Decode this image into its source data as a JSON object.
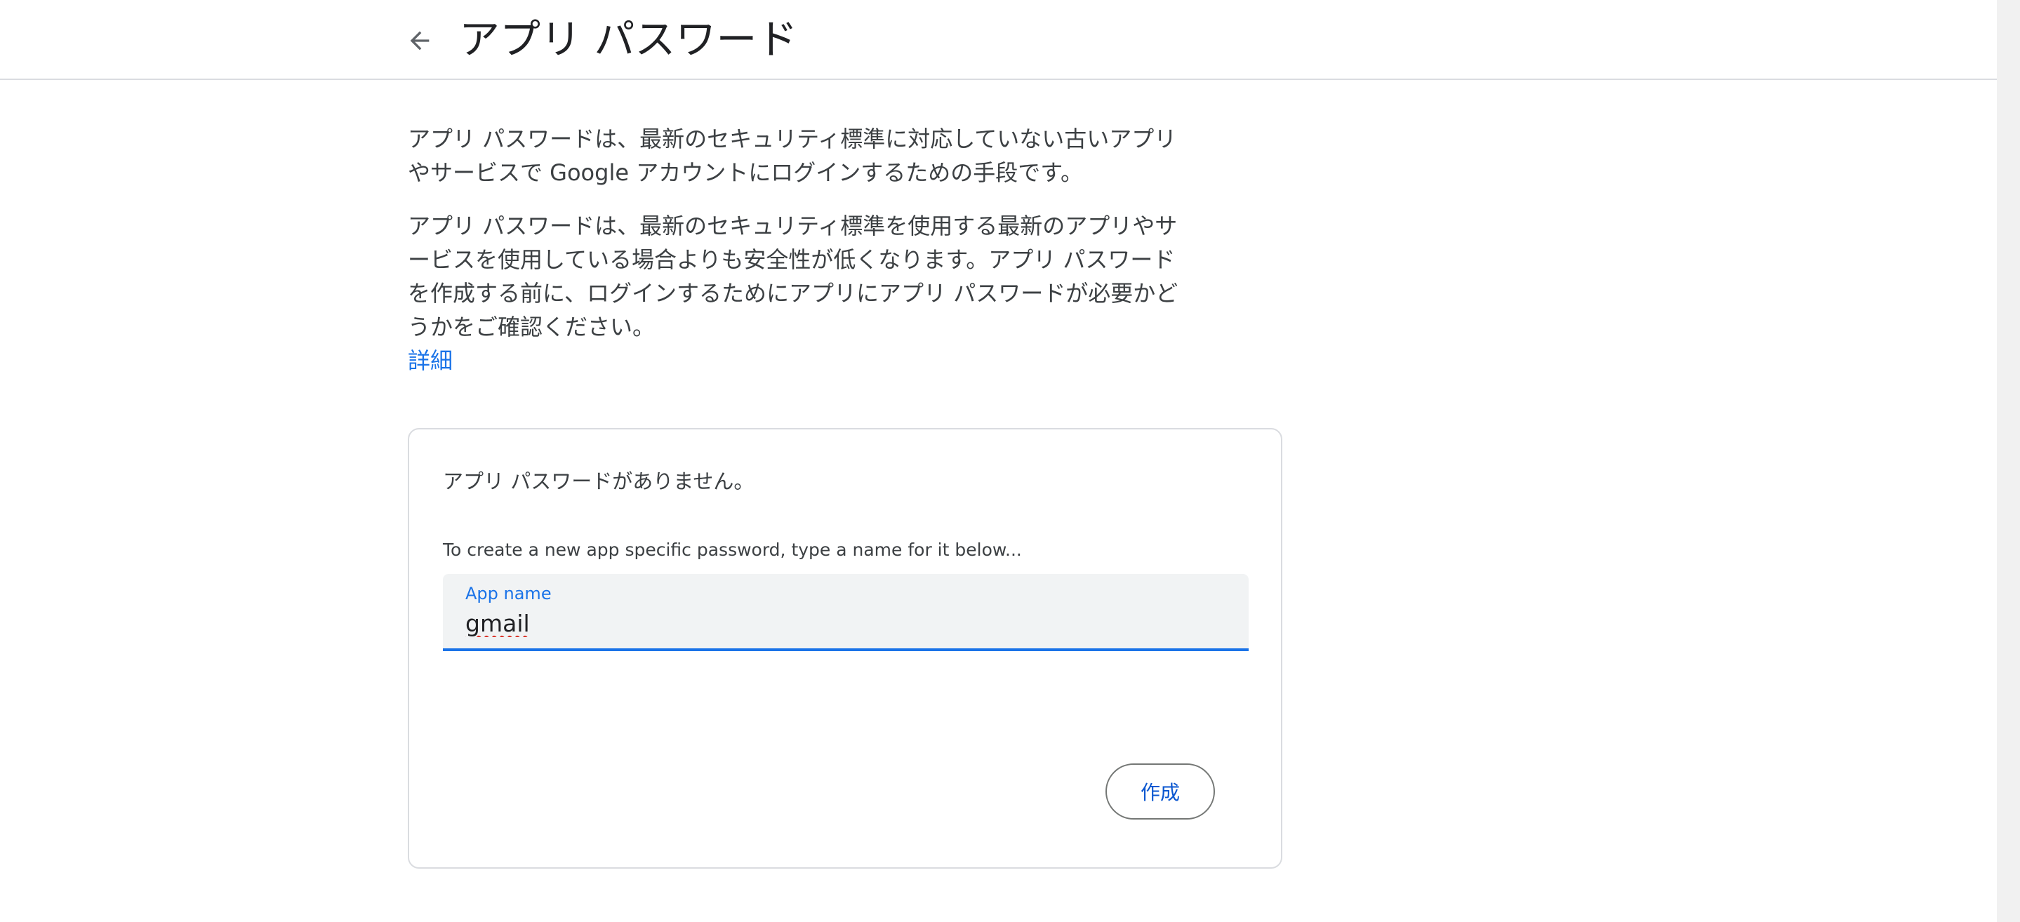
{
  "header": {
    "back_icon": "arrow-back-icon",
    "title": "アプリ パスワード"
  },
  "main": {
    "description_1": "アプリ パスワードは、最新のセキュリティ標準に対応していない古いアプリやサービスで Google アカウントにログインするための手段です。",
    "description_2": "アプリ パスワードは、最新のセキュリティ標準を使用する最新のアプリやサービスを使用している場合よりも安全性が低くなります。アプリ パスワードを作成する前に、ログインするためにアプリにアプリ パスワードが必要かどうかをご確認ください。",
    "learn_more_label": "詳細"
  },
  "card": {
    "empty_message": "アプリ パスワードがありません。",
    "instruction": "To create a new app specific password, type a name for it below...",
    "app_name_label": "App name",
    "app_name_value": "gmail",
    "create_button_label": "作成"
  },
  "colors": {
    "accent": "#1a73e8",
    "text": "#3c4043",
    "title": "#202124",
    "field_bg": "#f1f3f4",
    "border": "#dadce0"
  }
}
